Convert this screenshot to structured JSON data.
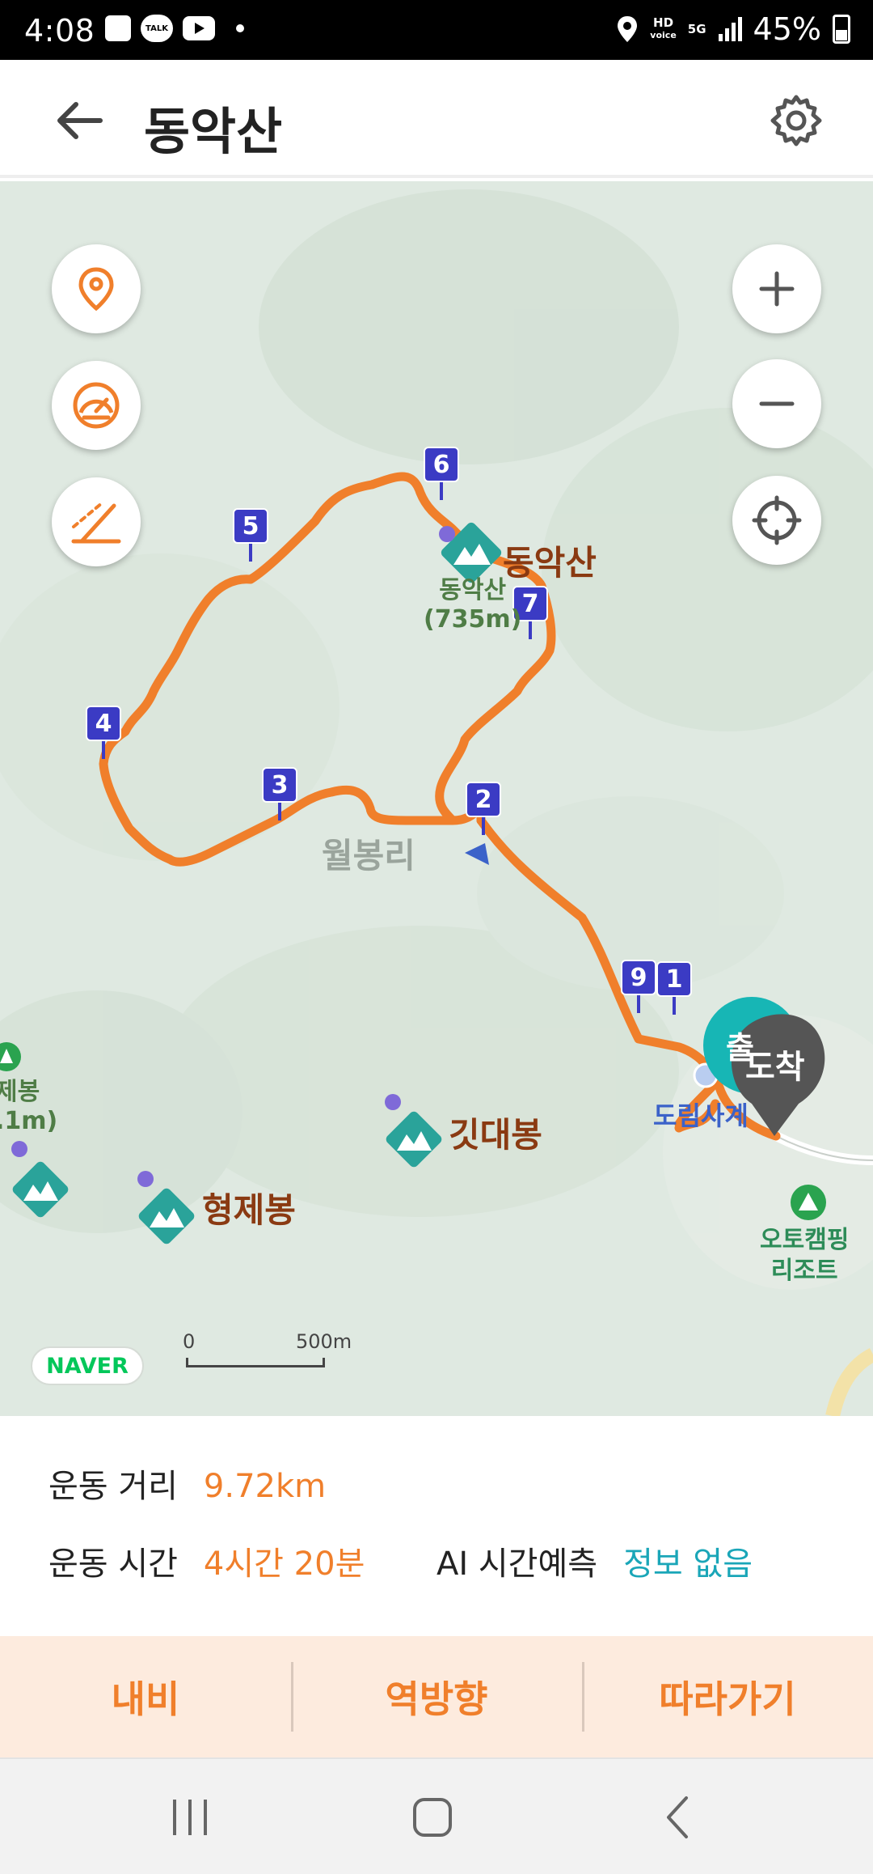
{
  "status_bar": {
    "time": "4:08",
    "talk_label": "TALK",
    "hd_voice": "HD",
    "voice_label": "voice",
    "network": "5G",
    "battery": "45%"
  },
  "header": {
    "title": "동악산"
  },
  "map": {
    "peaks": {
      "dongaksan_name": "동악산",
      "dongaksan_sub_name": "동악산",
      "dongaksan_elevation": "(735m)",
      "gitdaebong": "깃대봉",
      "hyeongjebong": "형제봉",
      "left_peak_partial_name": "제봉",
      "left_peak_partial_elev": ".1m)"
    },
    "village": "월봉리",
    "temple_partial": "도림사계",
    "camping_line1": "오토캠핑",
    "camping_line2": "리조트",
    "start_partial": "출",
    "arrival": "도착",
    "waypoints": [
      "1",
      "2",
      "3",
      "4",
      "5",
      "6",
      "7",
      "9"
    ],
    "naver_logo": "NAVER",
    "scale_zero": "0",
    "scale_500": "500m"
  },
  "info": {
    "distance_label": "운동 거리",
    "distance_value": "9.72km",
    "time_label": "운동 시간",
    "time_value": "4시간 20분",
    "ai_label": "AI 시간예측",
    "ai_value": "정보 없음"
  },
  "actions": {
    "navi": "내비",
    "reverse": "역방향",
    "follow": "따라가기"
  },
  "colors": {
    "route": "#f07f2b",
    "waypoint": "#3b3bc4",
    "peak_icon": "#2aa39a",
    "accent_teal": "#1aa6b8"
  }
}
